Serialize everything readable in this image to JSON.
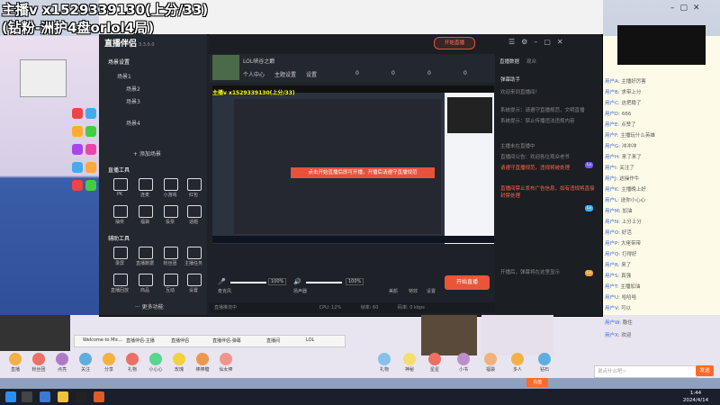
{
  "overlay": {
    "line1": "主播v x1529339130(上分/33)",
    "line2": "(钻粉-洲护4盘orlol4局)"
  },
  "app": {
    "logo": "直播伴侣",
    "version": "3.3.0.0",
    "room_title": "LOL峡谷之巅",
    "start_live_small": "开始直播",
    "header_items": [
      "个人中心",
      "主题设置",
      "设置"
    ],
    "header_stats": [
      "0",
      "0",
      "0",
      "0"
    ],
    "left_panel": {
      "scene_title": "场景设置",
      "scene_items": [
        "场景1",
        "场景2",
        "场景3",
        "场景4"
      ],
      "add_scene": "+ 添加场景",
      "tools_title": "直播工具",
      "tools": [
        "PK",
        "连麦",
        "小游戏",
        "红包",
        "抽奖",
        "福袋",
        "投票",
        "话题",
        "更多"
      ],
      "more_tools_title": "辅助工具",
      "more_tools": [
        "录屏",
        "直播数据",
        "粉丝团",
        "主播任务",
        "直播回放",
        "商品",
        "互动",
        "设置"
      ],
      "more": "··· 更多功能"
    },
    "preview_overlay": "主播v x1529339130(上分/33)",
    "preview_toast": "点击开始直播后即可开播，开播后请遵守直播规范",
    "controls": {
      "mic_pct": "100%",
      "speaker_pct": "100%",
      "mic_label": "麦克风",
      "speaker_label": "扬声器",
      "start_button": "开始直播",
      "icon_labels": [
        "美颜",
        "特效",
        "设置"
      ]
    },
    "status": [
      "直播推流中",
      "CPU: 12%",
      "帧率: 60",
      "码率: 0 kbps"
    ],
    "right_panel": {
      "tab1": "直播数据",
      "tab2": "观众",
      "title": "弹幕助手",
      "lines": [
        "欢迎来到直播间！",
        "系统提示：请遵守直播规范，文明直播",
        "系统提示：禁止传播违法违规内容",
        "主播未在直播中",
        "直播间公告：欢迎各位观众老爷",
        "禁止刷屏，理性发言"
      ],
      "red_lines": [
        "请遵守直播规范，违规将被处理",
        "直播间禁止发布广告信息，如有违规将直接封禁处理"
      ],
      "footer": "开播后，弹幕将在这里显示"
    }
  },
  "chat": {
    "lines": [
      {
        "name": "用户A",
        "text": "主播好厉害"
      },
      {
        "name": "用户B",
        "text": "求带上分"
      },
      {
        "name": "用户C",
        "text": "这把稳了"
      },
      {
        "name": "用户D",
        "text": "666"
      },
      {
        "name": "用户E",
        "text": "点赞了"
      },
      {
        "name": "用户F",
        "text": "主播玩什么英雄"
      },
      {
        "name": "用户G",
        "text": "冲冲冲"
      },
      {
        "name": "用户H",
        "text": "来了来了"
      },
      {
        "name": "用户I",
        "text": "关注了"
      },
      {
        "name": "用户J",
        "text": "这操作牛"
      },
      {
        "name": "用户K",
        "text": "主播晚上好"
      },
      {
        "name": "用户L",
        "text": "送你小心心"
      },
      {
        "name": "用户M",
        "text": "加油"
      },
      {
        "name": "用户N",
        "text": "上分上分"
      },
      {
        "name": "用户O",
        "text": "好活"
      },
      {
        "name": "用户P",
        "text": "大佬带带"
      },
      {
        "name": "用户Q",
        "text": "打得好"
      },
      {
        "name": "用户R",
        "text": "来了"
      },
      {
        "name": "用户S",
        "text": "真强"
      },
      {
        "name": "用户T",
        "text": "主播加油"
      },
      {
        "name": "用户U",
        "text": "哈哈哈"
      },
      {
        "name": "用户V",
        "text": "可以"
      },
      {
        "name": "用户W",
        "text": "稳住"
      },
      {
        "name": "用户X",
        "text": "欢迎"
      }
    ],
    "input_placeholder": "说点什么吧~",
    "send": "发送",
    "recharge": "充值"
  },
  "bottom_tabs": [
    "Welcome to Mic...",
    "直播伴侣-主播",
    "直播伴侣",
    "直播伴侣-弹幕",
    "直播间",
    "LOL"
  ],
  "gifts": [
    "直播",
    "粉丝团",
    "点亮",
    "关注",
    "分享",
    "礼物",
    "小心心",
    "玫瑰",
    "棒棒糖",
    "仙女棒",
    "私信",
    "超级火箭",
    "嘉年华",
    "跑车",
    "游轮",
    "飞机"
  ],
  "gift_row2": [
    "礼物",
    "神秘",
    "星星",
    "小书",
    "福袋",
    "多人",
    "钻石",
    "星愿"
  ],
  "clock": {
    "time": "1:44",
    "date": "2024/4/14"
  }
}
